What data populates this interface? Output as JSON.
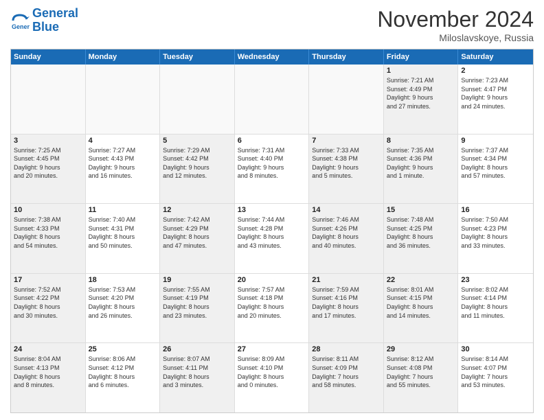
{
  "header": {
    "logo_line1": "General",
    "logo_line2": "Blue",
    "month": "November 2024",
    "location": "Miloslavskoye, Russia"
  },
  "weekdays": [
    "Sunday",
    "Monday",
    "Tuesday",
    "Wednesday",
    "Thursday",
    "Friday",
    "Saturday"
  ],
  "rows": [
    [
      {
        "day": "",
        "info": "",
        "empty": true
      },
      {
        "day": "",
        "info": "",
        "empty": true
      },
      {
        "day": "",
        "info": "",
        "empty": true
      },
      {
        "day": "",
        "info": "",
        "empty": true
      },
      {
        "day": "",
        "info": "",
        "empty": true
      },
      {
        "day": "1",
        "info": "Sunrise: 7:21 AM\nSunset: 4:49 PM\nDaylight: 9 hours\nand 27 minutes.",
        "shaded": true
      },
      {
        "day": "2",
        "info": "Sunrise: 7:23 AM\nSunset: 4:47 PM\nDaylight: 9 hours\nand 24 minutes.",
        "shaded": false
      }
    ],
    [
      {
        "day": "3",
        "info": "Sunrise: 7:25 AM\nSunset: 4:45 PM\nDaylight: 9 hours\nand 20 minutes.",
        "shaded": true
      },
      {
        "day": "4",
        "info": "Sunrise: 7:27 AM\nSunset: 4:43 PM\nDaylight: 9 hours\nand 16 minutes.",
        "shaded": false
      },
      {
        "day": "5",
        "info": "Sunrise: 7:29 AM\nSunset: 4:42 PM\nDaylight: 9 hours\nand 12 minutes.",
        "shaded": true
      },
      {
        "day": "6",
        "info": "Sunrise: 7:31 AM\nSunset: 4:40 PM\nDaylight: 9 hours\nand 8 minutes.",
        "shaded": false
      },
      {
        "day": "7",
        "info": "Sunrise: 7:33 AM\nSunset: 4:38 PM\nDaylight: 9 hours\nand 5 minutes.",
        "shaded": true
      },
      {
        "day": "8",
        "info": "Sunrise: 7:35 AM\nSunset: 4:36 PM\nDaylight: 9 hours\nand 1 minute.",
        "shaded": true
      },
      {
        "day": "9",
        "info": "Sunrise: 7:37 AM\nSunset: 4:34 PM\nDaylight: 8 hours\nand 57 minutes.",
        "shaded": false
      }
    ],
    [
      {
        "day": "10",
        "info": "Sunrise: 7:38 AM\nSunset: 4:33 PM\nDaylight: 8 hours\nand 54 minutes.",
        "shaded": true
      },
      {
        "day": "11",
        "info": "Sunrise: 7:40 AM\nSunset: 4:31 PM\nDaylight: 8 hours\nand 50 minutes.",
        "shaded": false
      },
      {
        "day": "12",
        "info": "Sunrise: 7:42 AM\nSunset: 4:29 PM\nDaylight: 8 hours\nand 47 minutes.",
        "shaded": true
      },
      {
        "day": "13",
        "info": "Sunrise: 7:44 AM\nSunset: 4:28 PM\nDaylight: 8 hours\nand 43 minutes.",
        "shaded": false
      },
      {
        "day": "14",
        "info": "Sunrise: 7:46 AM\nSunset: 4:26 PM\nDaylight: 8 hours\nand 40 minutes.",
        "shaded": true
      },
      {
        "day": "15",
        "info": "Sunrise: 7:48 AM\nSunset: 4:25 PM\nDaylight: 8 hours\nand 36 minutes.",
        "shaded": true
      },
      {
        "day": "16",
        "info": "Sunrise: 7:50 AM\nSunset: 4:23 PM\nDaylight: 8 hours\nand 33 minutes.",
        "shaded": false
      }
    ],
    [
      {
        "day": "17",
        "info": "Sunrise: 7:52 AM\nSunset: 4:22 PM\nDaylight: 8 hours\nand 30 minutes.",
        "shaded": true
      },
      {
        "day": "18",
        "info": "Sunrise: 7:53 AM\nSunset: 4:20 PM\nDaylight: 8 hours\nand 26 minutes.",
        "shaded": false
      },
      {
        "day": "19",
        "info": "Sunrise: 7:55 AM\nSunset: 4:19 PM\nDaylight: 8 hours\nand 23 minutes.",
        "shaded": true
      },
      {
        "day": "20",
        "info": "Sunrise: 7:57 AM\nSunset: 4:18 PM\nDaylight: 8 hours\nand 20 minutes.",
        "shaded": false
      },
      {
        "day": "21",
        "info": "Sunrise: 7:59 AM\nSunset: 4:16 PM\nDaylight: 8 hours\nand 17 minutes.",
        "shaded": true
      },
      {
        "day": "22",
        "info": "Sunrise: 8:01 AM\nSunset: 4:15 PM\nDaylight: 8 hours\nand 14 minutes.",
        "shaded": true
      },
      {
        "day": "23",
        "info": "Sunrise: 8:02 AM\nSunset: 4:14 PM\nDaylight: 8 hours\nand 11 minutes.",
        "shaded": false
      }
    ],
    [
      {
        "day": "24",
        "info": "Sunrise: 8:04 AM\nSunset: 4:13 PM\nDaylight: 8 hours\nand 8 minutes.",
        "shaded": true
      },
      {
        "day": "25",
        "info": "Sunrise: 8:06 AM\nSunset: 4:12 PM\nDaylight: 8 hours\nand 6 minutes.",
        "shaded": false
      },
      {
        "day": "26",
        "info": "Sunrise: 8:07 AM\nSunset: 4:11 PM\nDaylight: 8 hours\nand 3 minutes.",
        "shaded": true
      },
      {
        "day": "27",
        "info": "Sunrise: 8:09 AM\nSunset: 4:10 PM\nDaylight: 8 hours\nand 0 minutes.",
        "shaded": false
      },
      {
        "day": "28",
        "info": "Sunrise: 8:11 AM\nSunset: 4:09 PM\nDaylight: 7 hours\nand 58 minutes.",
        "shaded": true
      },
      {
        "day": "29",
        "info": "Sunrise: 8:12 AM\nSunset: 4:08 PM\nDaylight: 7 hours\nand 55 minutes.",
        "shaded": true
      },
      {
        "day": "30",
        "info": "Sunrise: 8:14 AM\nSunset: 4:07 PM\nDaylight: 7 hours\nand 53 minutes.",
        "shaded": false
      }
    ]
  ]
}
